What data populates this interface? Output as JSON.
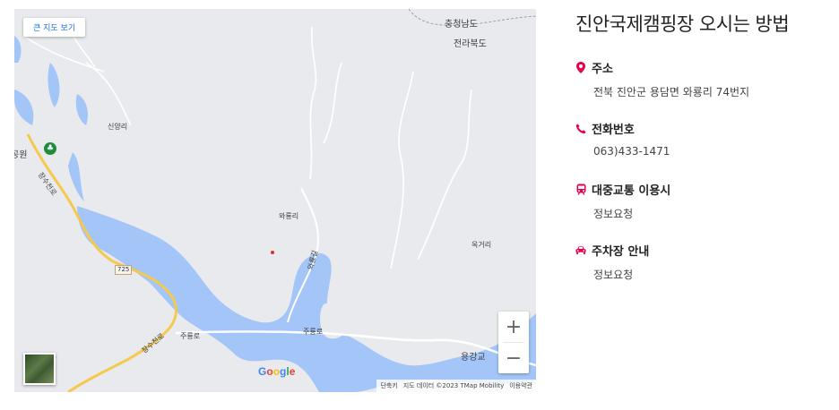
{
  "map": {
    "big_map_button": "큰 지도 보기",
    "labels": {
      "chungnam": "충청남도",
      "jeonbuk": "전라북도",
      "sinyang": "신양리",
      "waryong": "와룡리",
      "okgeo": "옥거리",
      "park": "공원",
      "jangsu_road1": "장수천로",
      "jangsu_road2": "장수천로",
      "juyong_road1": "주룡로",
      "juyong_road2": "주룡로",
      "waryong_gil": "와룡길",
      "yonggang": "용강교",
      "route": "725"
    },
    "zoom_in": "+",
    "zoom_out": "−",
    "google_logo": "Google",
    "attribution": {
      "shortcuts": "단축키",
      "data": "지도 데이터 ©2023 TMap Mobility",
      "terms": "이용약관"
    },
    "colors": {
      "water": "#a3c5f7",
      "land": "#e8eaed",
      "road": "#f6c94e"
    }
  },
  "info": {
    "title": "진안국제캠핑장 오시는 방법",
    "address": {
      "label": "주소",
      "value": "전북 진안군 용담면 와룡리 74번지"
    },
    "phone": {
      "label": "전화번호",
      "value": "063)433-1471"
    },
    "transit": {
      "label": "대중교통 이용시",
      "value": "정보요청"
    },
    "parking": {
      "label": "주차장 안내",
      "value": "정보요청"
    },
    "accent_color": "#e5004f"
  }
}
